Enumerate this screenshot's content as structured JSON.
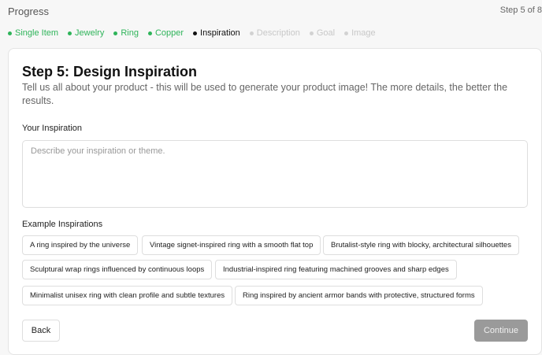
{
  "header": {
    "title": "Progress",
    "step_count": "Step 5 of 8"
  },
  "steps": [
    {
      "label": "Single Item",
      "state": "done"
    },
    {
      "label": "Jewelry",
      "state": "done"
    },
    {
      "label": "Ring",
      "state": "done"
    },
    {
      "label": "Copper",
      "state": "done"
    },
    {
      "label": "Inspiration",
      "state": "current"
    },
    {
      "label": "Description",
      "state": "todo"
    },
    {
      "label": "Goal",
      "state": "todo"
    },
    {
      "label": "Image",
      "state": "todo"
    }
  ],
  "card": {
    "title": "Step 5: Design Inspiration",
    "description": "Tell us all about your product - this will be used to generate your product image! The more details, the better the results.",
    "inspiration_label": "Your Inspiration",
    "inspiration_value": "",
    "inspiration_placeholder": "Describe your inspiration or theme.",
    "examples_label": "Example Inspirations",
    "examples": [
      "A ring inspired by the universe",
      "Vintage signet-inspired ring with a smooth flat top",
      "Brutalist-style ring with blocky, architectural silhouettes",
      "Sculptural wrap rings influenced by continuous loops",
      "Industrial-inspired ring featuring machined grooves and sharp edges",
      "Minimalist unisex ring with clean profile and subtle textures",
      "Ring inspired by ancient armor bands with protective, structured forms"
    ],
    "back_label": "Back",
    "continue_label": "Continue"
  },
  "colors": {
    "done": "#2fb45a",
    "current": "#111111",
    "todo": "#d2d2d2",
    "continue_disabled": "#9a9a9a"
  }
}
